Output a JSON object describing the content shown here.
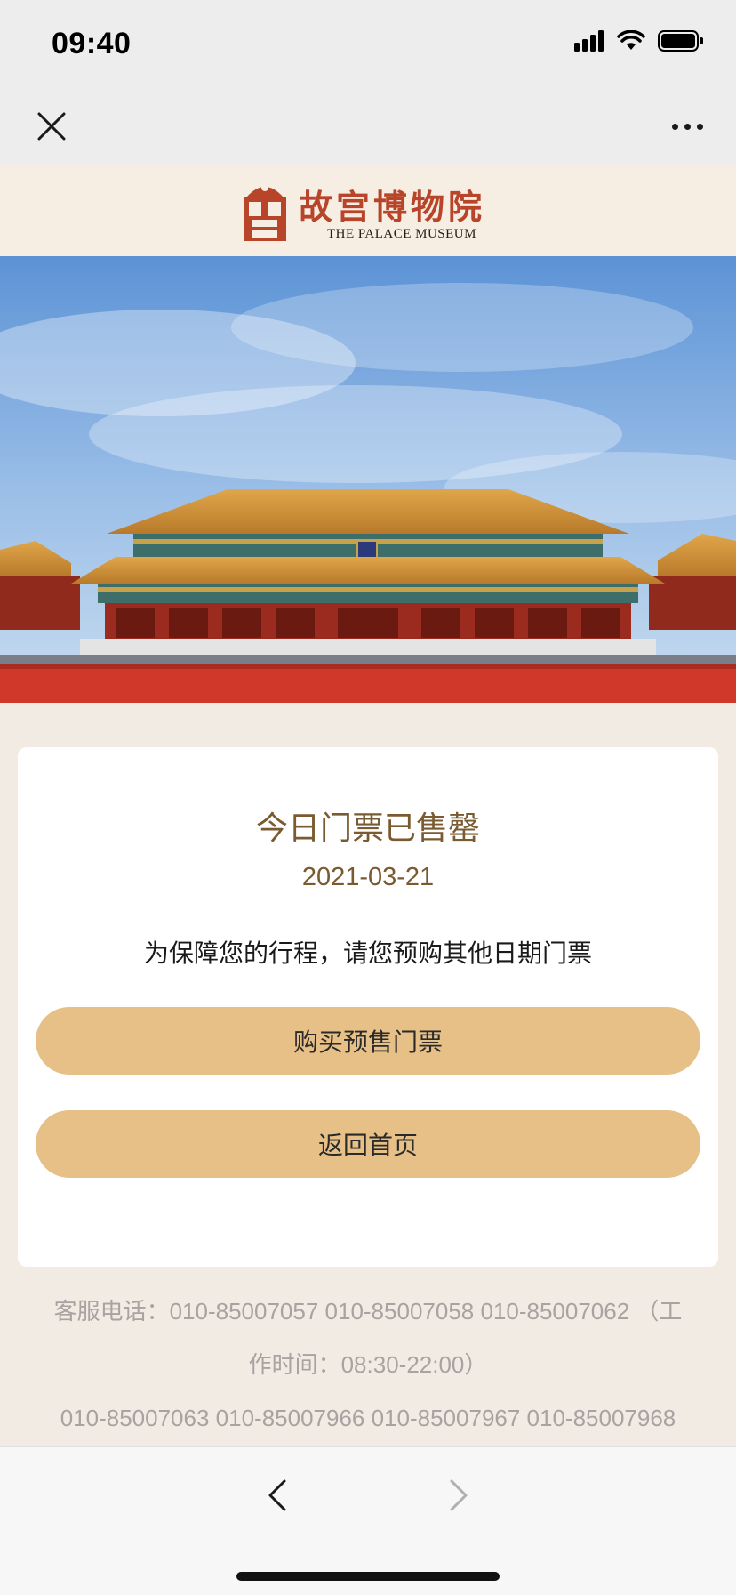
{
  "status": {
    "time": "09:40"
  },
  "nav": {
    "close_icon": "close-icon",
    "more_icon": "more-icon"
  },
  "brand": {
    "name_cn": "故宫博物院",
    "name_en": "THE PALACE MUSEUM",
    "color": "#b8452a"
  },
  "card": {
    "title": "今日门票已售罄",
    "date": "2021-03-21",
    "message": "为保障您的行程，请您预购其他日期门票",
    "buy_label": "购买预售门票",
    "home_label": "返回首页"
  },
  "contact": {
    "line1": "客服电话：010-85007057 010-85007058 010-85007062 （工",
    "line2": "作时间：08:30-22:00）",
    "line3": "010-85007063 010-85007966 010-85007967 010-85007968"
  },
  "colors": {
    "accent": "#e6c087",
    "title": "#7a5a30",
    "background": "#f2ebe4"
  }
}
